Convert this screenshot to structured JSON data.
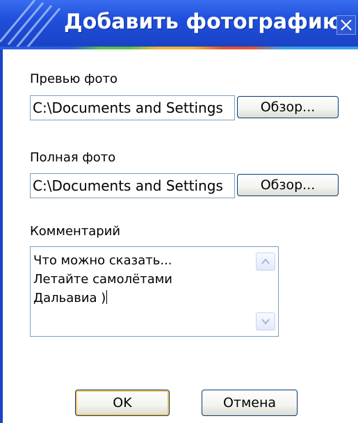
{
  "window": {
    "title": "Добавить фотографию",
    "close_icon": "close-icon"
  },
  "preview": {
    "label": "Превью фото",
    "value": "C:\\Documents and Settings",
    "browse_label": "Обзор..."
  },
  "full": {
    "label": "Полная фото",
    "value": "C:\\Documents and Settings",
    "browse_label": "Обзор..."
  },
  "comment": {
    "label": "Комментарий",
    "lines": [
      "Что можно сказать...",
      "Летайте самолётами",
      "Дальавиа )"
    ],
    "scroll_up_icon": "chevron-up-icon",
    "scroll_down_icon": "chevron-down-icon"
  },
  "buttons": {
    "ok_label": "OK",
    "cancel_label": "Отмена"
  },
  "colors": {
    "titlebar": "#1c45c8",
    "default_button_highlight": "#f7c55a",
    "field_border": "#7f9db9"
  }
}
